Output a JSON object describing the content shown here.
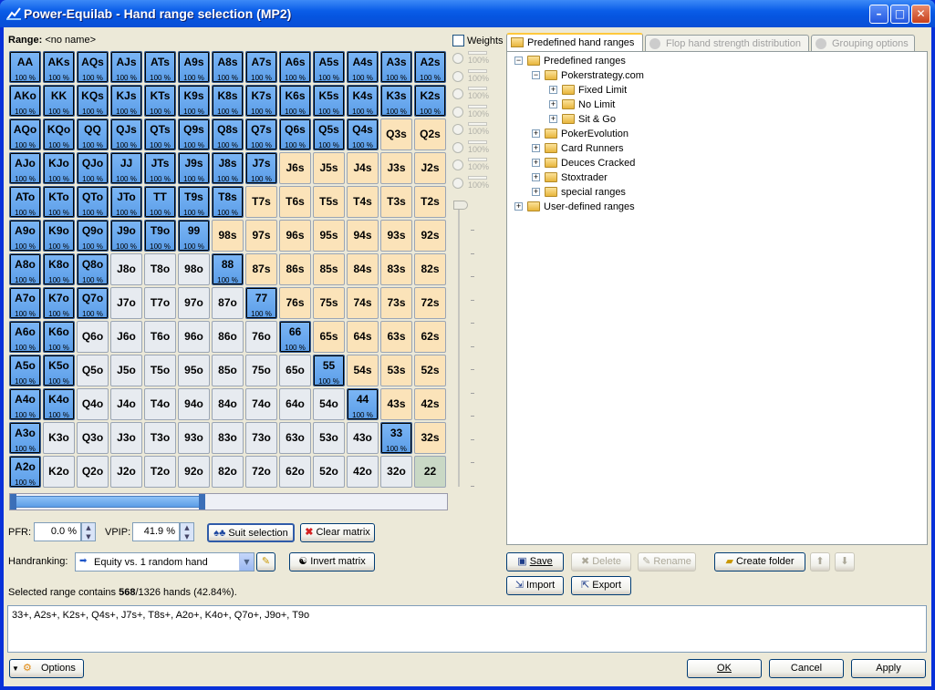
{
  "window": {
    "title": "Power-Equilab - Hand range selection (MP2)"
  },
  "range": {
    "label": "Range:",
    "name": "<no name>"
  },
  "weights": {
    "label": "Weights",
    "levels": [
      "100%",
      "100%",
      "100%",
      "100%",
      "100%",
      "100%",
      "100%",
      "100%"
    ]
  },
  "matrix": {
    "ranks": [
      "A",
      "K",
      "Q",
      "J",
      "T",
      "9",
      "8",
      "7",
      "6",
      "5",
      "4",
      "3",
      "2"
    ],
    "rows": [
      [
        "AA",
        "AKs",
        "AQs",
        "AJs",
        "ATs",
        "A9s",
        "A8s",
        "A7s",
        "A6s",
        "A5s",
        "A4s",
        "A3s",
        "A2s"
      ],
      [
        "AKo",
        "KK",
        "KQs",
        "KJs",
        "KTs",
        "K9s",
        "K8s",
        "K7s",
        "K6s",
        "K5s",
        "K4s",
        "K3s",
        "K2s"
      ],
      [
        "AQo",
        "KQo",
        "QQ",
        "QJs",
        "QTs",
        "Q9s",
        "Q8s",
        "Q7s",
        "Q6s",
        "Q5s",
        "Q4s",
        "Q3s",
        "Q2s"
      ],
      [
        "AJo",
        "KJo",
        "QJo",
        "JJ",
        "JTs",
        "J9s",
        "J8s",
        "J7s",
        "J6s",
        "J5s",
        "J4s",
        "J3s",
        "J2s"
      ],
      [
        "ATo",
        "KTo",
        "QTo",
        "JTo",
        "TT",
        "T9s",
        "T8s",
        "T7s",
        "T6s",
        "T5s",
        "T4s",
        "T3s",
        "T2s"
      ],
      [
        "A9o",
        "K9o",
        "Q9o",
        "J9o",
        "T9o",
        "99",
        "98s",
        "97s",
        "96s",
        "95s",
        "94s",
        "93s",
        "92s"
      ],
      [
        "A8o",
        "K8o",
        "Q8o",
        "J8o",
        "T8o",
        "98o",
        "88",
        "87s",
        "86s",
        "85s",
        "84s",
        "83s",
        "82s"
      ],
      [
        "A7o",
        "K7o",
        "Q7o",
        "J7o",
        "T7o",
        "97o",
        "87o",
        "77",
        "76s",
        "75s",
        "74s",
        "73s",
        "72s"
      ],
      [
        "A6o",
        "K6o",
        "Q6o",
        "J6o",
        "T6o",
        "96o",
        "86o",
        "76o",
        "66",
        "65s",
        "64s",
        "63s",
        "62s"
      ],
      [
        "A5o",
        "K5o",
        "Q5o",
        "J5o",
        "T5o",
        "95o",
        "85o",
        "75o",
        "65o",
        "55",
        "54s",
        "53s",
        "52s"
      ],
      [
        "A4o",
        "K4o",
        "Q4o",
        "J4o",
        "T4o",
        "94o",
        "84o",
        "74o",
        "64o",
        "54o",
        "44",
        "43s",
        "42s"
      ],
      [
        "A3o",
        "K3o",
        "Q3o",
        "J3o",
        "T3o",
        "93o",
        "83o",
        "73o",
        "63o",
        "53o",
        "43o",
        "33",
        "32s"
      ],
      [
        "A2o",
        "K2o",
        "Q2o",
        "J2o",
        "T2o",
        "92o",
        "82o",
        "72o",
        "62o",
        "52o",
        "42o",
        "32o",
        "22"
      ]
    ],
    "selected": [
      [
        1,
        1,
        1,
        1,
        1,
        1,
        1,
        1,
        1,
        1,
        1,
        1,
        1
      ],
      [
        1,
        1,
        1,
        1,
        1,
        1,
        1,
        1,
        1,
        1,
        1,
        1,
        1
      ],
      [
        1,
        1,
        1,
        1,
        1,
        1,
        1,
        1,
        1,
        1,
        1,
        0,
        0
      ],
      [
        1,
        1,
        1,
        1,
        1,
        1,
        1,
        1,
        0,
        0,
        0,
        0,
        0
      ],
      [
        1,
        1,
        1,
        1,
        1,
        1,
        1,
        0,
        0,
        0,
        0,
        0,
        0
      ],
      [
        1,
        1,
        1,
        1,
        1,
        1,
        0,
        0,
        0,
        0,
        0,
        0,
        0
      ],
      [
        1,
        1,
        1,
        0,
        0,
        0,
        1,
        0,
        0,
        0,
        0,
        0,
        0
      ],
      [
        1,
        1,
        1,
        0,
        0,
        0,
        0,
        1,
        0,
        0,
        0,
        0,
        0
      ],
      [
        1,
        1,
        0,
        0,
        0,
        0,
        0,
        0,
        1,
        0,
        0,
        0,
        0
      ],
      [
        1,
        1,
        0,
        0,
        0,
        0,
        0,
        0,
        0,
        1,
        0,
        0,
        0
      ],
      [
        1,
        1,
        0,
        0,
        0,
        0,
        0,
        0,
        0,
        0,
        1,
        0,
        0
      ],
      [
        1,
        0,
        0,
        0,
        0,
        0,
        0,
        0,
        0,
        0,
        0,
        1,
        0
      ],
      [
        1,
        0,
        0,
        0,
        0,
        0,
        0,
        0,
        0,
        0,
        0,
        0,
        0
      ]
    ],
    "pct_label": "100 %"
  },
  "controls": {
    "pfr_label": "PFR:",
    "pfr_value": "0.0 %",
    "vpip_label": "VPIP:",
    "vpip_value": "41.9 %",
    "suit_selection": "Suit selection",
    "clear_matrix": "Clear matrix",
    "handranking_label": "Handranking:",
    "handranking_value": "Equity vs. 1 random hand",
    "invert_matrix": "Invert matrix"
  },
  "summary": {
    "prefix": "Selected range contains ",
    "count": "568",
    "suffix": "/1326 hands (42.84%)."
  },
  "range_text": "33+, A2s+, K2s+, Q4s+, J7s+, T8s+, A2o+, K4o+, Q7o+, J9o+, T9o",
  "tabs": [
    {
      "label": "Predefined hand ranges",
      "active": true,
      "icon": "folder-icon"
    },
    {
      "label": "Flop hand strength distribution",
      "active": false,
      "icon": "chart-icon"
    },
    {
      "label": "Grouping options",
      "active": false,
      "icon": "group-icon"
    }
  ],
  "tree": [
    {
      "label": "Predefined ranges",
      "level": 0,
      "expander": "-"
    },
    {
      "label": "Pokerstrategy.com",
      "level": 1,
      "expander": "-"
    },
    {
      "label": "Fixed Limit",
      "level": 2,
      "expander": "+"
    },
    {
      "label": "No Limit",
      "level": 2,
      "expander": "+"
    },
    {
      "label": "Sit & Go",
      "level": 2,
      "expander": "+"
    },
    {
      "label": "PokerEvolution",
      "level": 1,
      "expander": "+"
    },
    {
      "label": "Card Runners",
      "level": 1,
      "expander": "+"
    },
    {
      "label": "Deuces Cracked",
      "level": 1,
      "expander": "+"
    },
    {
      "label": "Stoxtrader",
      "level": 1,
      "expander": "+"
    },
    {
      "label": "special ranges",
      "level": 1,
      "expander": "+"
    },
    {
      "label": "User-defined ranges",
      "level": 0,
      "expander": "+"
    }
  ],
  "tree_buttons": {
    "save": "Save",
    "delete": "Delete",
    "rename": "Rename",
    "create_folder": "Create folder",
    "import": "Import",
    "export": "Export"
  },
  "footer": {
    "options": "Options",
    "ok": "OK",
    "cancel": "Cancel",
    "apply": "Apply"
  },
  "colors": {
    "selected": "#6aa9ee",
    "suited": "#fbe3b9",
    "offsuit": "#e7ebf0",
    "pair": "#c9d8c5",
    "title": "#0a5de8"
  }
}
